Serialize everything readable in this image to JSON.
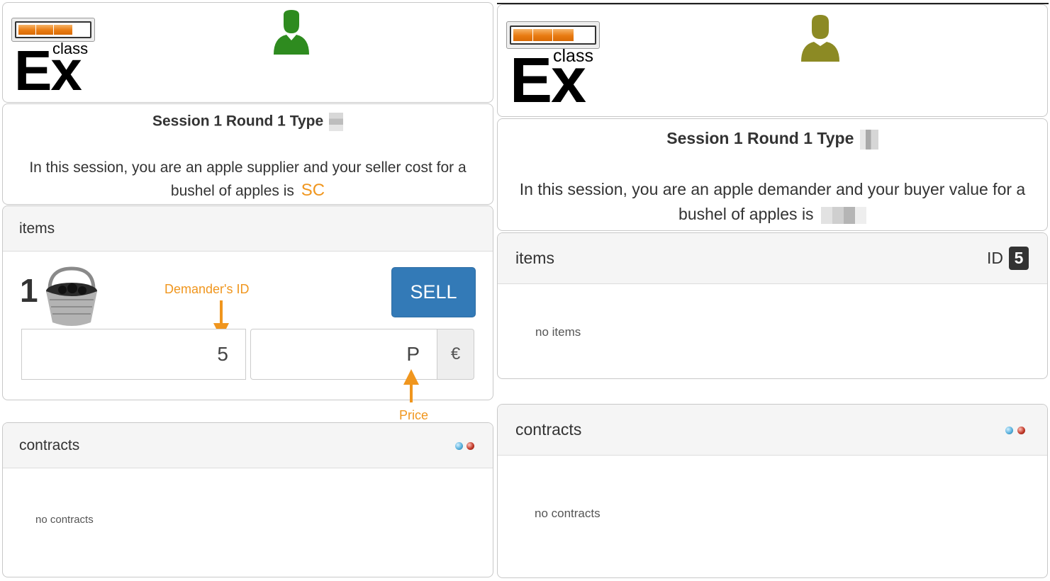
{
  "colors": {
    "accent_orange": "#f0961e",
    "sell_button": "#337ab7",
    "supplier_avatar": "#2e8b1f",
    "demander_avatar": "#8c8a24",
    "status_blue": "#5bb2de",
    "status_red": "#c23a2a",
    "panel_header": "#f5f5f5"
  },
  "left": {
    "logo": {
      "text_main": "Ex",
      "text_small": "class",
      "progress_filled_segments": 3,
      "progress_total_segments": 4
    },
    "avatar_icon": "user-icon",
    "session_title": "Session 1 Round 1 Type",
    "description": "In this session, you are an apple supplier and your seller cost for a bushel of apples is",
    "cost_value": "SC",
    "items_label": "items",
    "item": {
      "number": "1",
      "image_icon": "basket-icon",
      "sell_label": "SELL",
      "id_value": "5",
      "price_value": "P",
      "currency": "€"
    },
    "annotations": {
      "demander_id": "Demander's ID",
      "price": "Price"
    },
    "contracts_label": "contracts",
    "no_contracts": "no contracts"
  },
  "right": {
    "logo": {
      "text_main": "Ex",
      "text_small": "class",
      "progress_filled_segments": 3,
      "progress_total_segments": 4
    },
    "avatar_icon": "user-icon",
    "session_title": "Session 1 Round 1 Type",
    "description": "In this session, you are an apple demander and your buyer value for a bushel of apples is",
    "items_label": "items",
    "id_label": "ID",
    "id_value": "5",
    "no_items": "no items",
    "contracts_label": "contracts",
    "no_contracts": "no contracts"
  }
}
